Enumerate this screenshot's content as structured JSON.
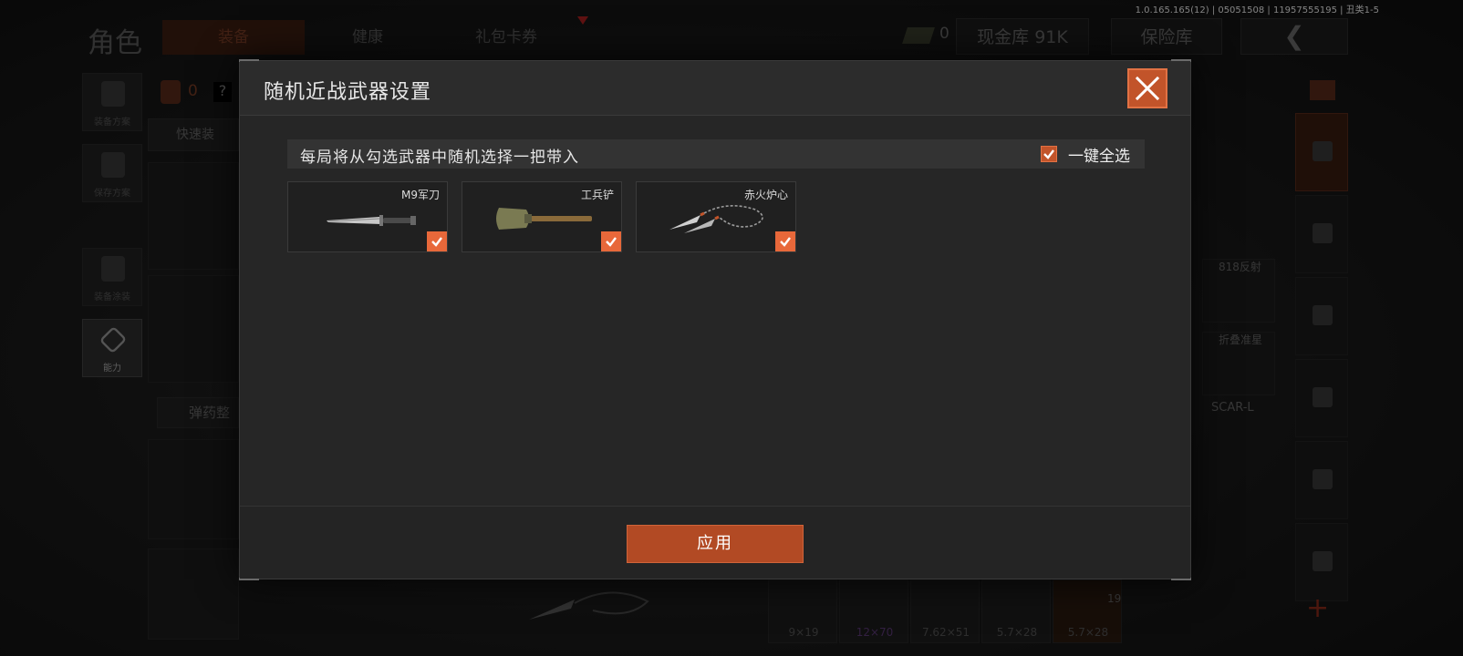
{
  "version_text": "1.0.165.165(12) | 05051508 | 11957555195 | 丑类1-5",
  "background": {
    "page_title": "角色",
    "tabs": [
      {
        "label": "装备",
        "active": true
      },
      {
        "label": "健康",
        "active": false
      },
      {
        "label": "礼包卡券",
        "active": false
      }
    ],
    "cash_count": "0",
    "vault_button": "现金库 91K",
    "safe_button": "保险库",
    "left_nav": [
      {
        "label": "装备方案",
        "icon": "backpack-icon"
      },
      {
        "label": "保存方案",
        "icon": "download-icon"
      },
      {
        "label": "装备涂装",
        "icon": "helmet-icon"
      },
      {
        "label": "能力",
        "icon": "ability-icon",
        "active": true
      }
    ],
    "bag_count": "0",
    "question_mark": "?",
    "quick_equip": "快速装",
    "ammo_button": "弹药整",
    "right_labels": [
      "818反射",
      "折叠准星",
      "SCAR-L"
    ],
    "ammo_types": [
      {
        "label": "9×19",
        "color": "#555555"
      },
      {
        "label": "12×70",
        "color": "#5d3b78"
      },
      {
        "label": "7.62×51",
        "color": "#555555"
      },
      {
        "label": "5.7×28",
        "color": "#555555"
      },
      {
        "label": "5.7×28",
        "color": "#555555"
      }
    ],
    "ammo_count": "19",
    "plus_symbol": "+"
  },
  "modal": {
    "title": "随机近战武器设置",
    "info_text": "每局将从勾选武器中随机选择一把带入",
    "select_all_label": "一键全选",
    "select_all_checked": true,
    "weapons": [
      {
        "name": "M9军刀",
        "checked": true,
        "icon": "bayonet-icon"
      },
      {
        "name": "工兵铲",
        "checked": true,
        "icon": "shovel-icon"
      },
      {
        "name": "赤火炉心",
        "checked": true,
        "icon": "rope-dart-icon"
      }
    ],
    "apply_label": "应用"
  },
  "colors": {
    "accent": "#c2542a",
    "accent_bright": "#e8683a",
    "modal_bg": "#262626"
  }
}
